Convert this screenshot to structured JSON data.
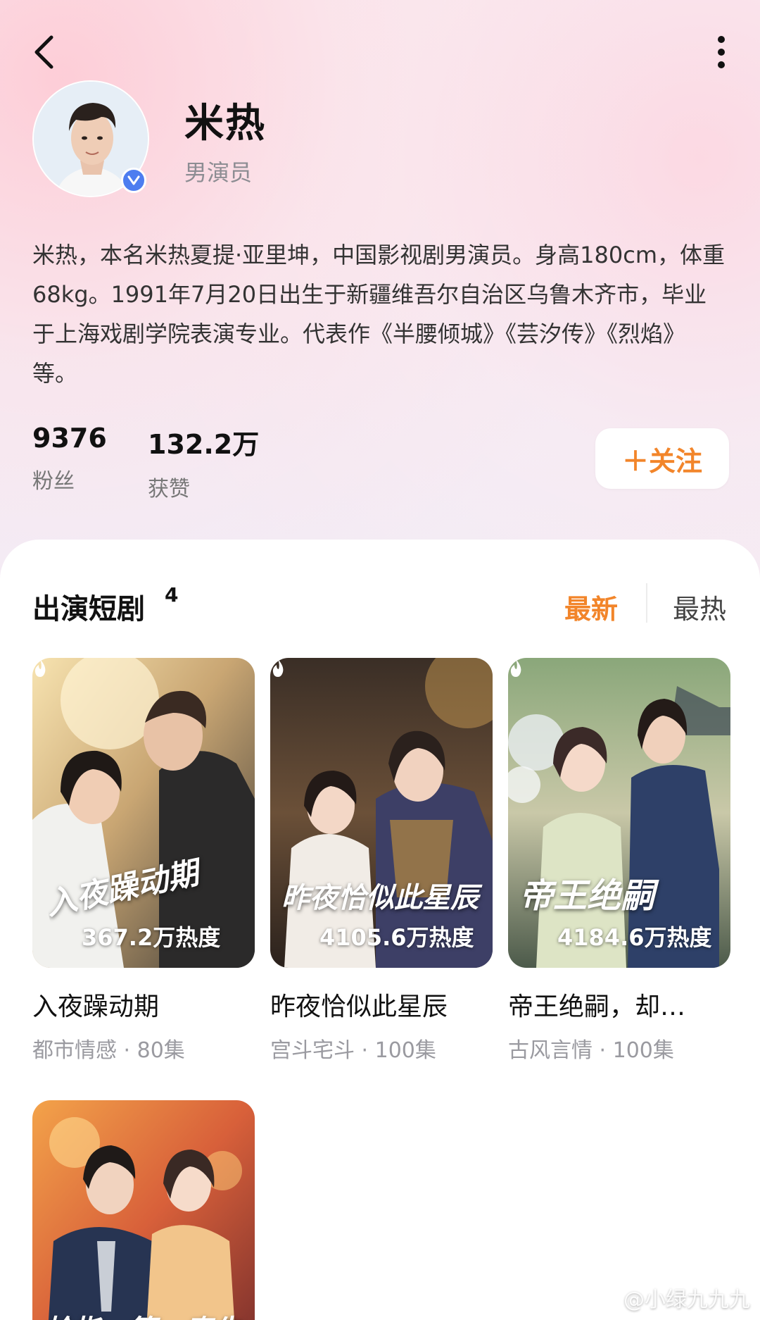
{
  "profile": {
    "name": "米热",
    "role": "男演员",
    "bio": "米热，本名米热夏提·亚里坤，中国影视剧男演员。身高180cm，体重68kg。1991年7月20日出生于新疆维吾尔自治区乌鲁木齐市，毕业于上海戏剧学院表演专业。代表作《半腰倾城》《芸汐传》《烈焰》等。",
    "verified": true
  },
  "stats": {
    "fans_value": "9376",
    "fans_label": "粉丝",
    "likes_value": "132.2万",
    "likes_label": "获赞"
  },
  "follow_button": "＋关注",
  "section": {
    "title": "出演短剧",
    "count": "4",
    "sort_latest": "最新",
    "sort_hot": "最热"
  },
  "dramas": [
    {
      "title": "入夜躁动期",
      "poster_text": "入夜躁动期",
      "heat": "367.2万热度",
      "meta": "都市情感 · 80集"
    },
    {
      "title": "昨夜恰似此星辰",
      "poster_text": "昨夜恰似此星辰",
      "heat": "4105.6万热度",
      "meta": "宫斗宅斗 · 100集"
    },
    {
      "title": "帝王绝嗣，却…",
      "poster_text": "帝王绝嗣",
      "heat": "4184.6万热度",
      "meta": "古风言情 · 100集"
    },
    {
      "title": "",
      "poster_text": "拾指一算，秦先生",
      "heat": "",
      "meta": ""
    }
  ],
  "watermark": "@小绿九九九",
  "colors": {
    "accent": "#f2852a",
    "verified": "#4d7df0"
  }
}
